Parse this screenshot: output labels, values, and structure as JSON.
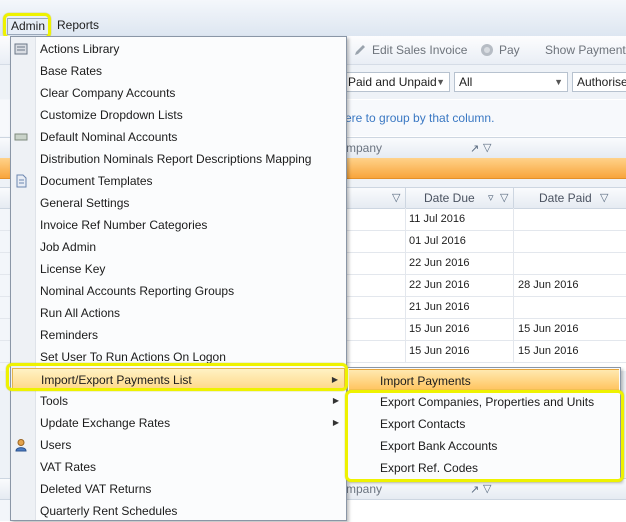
{
  "menubar": {
    "admin": "Admin",
    "reports": "Reports"
  },
  "toolbar": {
    "edit_sales_invoice": "Edit Sales Invoice",
    "pay": "Pay",
    "show_payment": "Show Payment"
  },
  "filters": {
    "status": "Paid and Unpaid",
    "scope": "All",
    "authorised": "Authorise"
  },
  "group_hint": "ere to group by that column.",
  "grid": {
    "group_column": "mpany",
    "columns": {
      "date_due": "Date Due",
      "date_paid": "Date Paid"
    },
    "rows": [
      {
        "date_due": "11 Jul 2016",
        "date_paid": ""
      },
      {
        "date_due": "01 Jul 2016",
        "date_paid": ""
      },
      {
        "date_due": "22 Jun 2016",
        "date_paid": ""
      },
      {
        "date_due": "22 Jun 2016",
        "date_paid": "28 Jun 2016"
      },
      {
        "date_due": "21 Jun 2016",
        "date_paid": ""
      },
      {
        "date_due": "15 Jun 2016",
        "date_paid": "15 Jun 2016"
      },
      {
        "date_due": "15 Jun 2016",
        "date_paid": "15 Jun 2016"
      }
    ],
    "lower_group_column": "mpany"
  },
  "admin_menu": {
    "items": [
      "Actions Library",
      "Base Rates",
      "Clear Company Accounts",
      "Customize Dropdown Lists",
      "Default Nominal Accounts",
      "Distribution Nominals Report Descriptions Mapping",
      "Document Templates",
      "General Settings",
      "Invoice Ref Number Categories",
      "Job Admin",
      "License Key",
      "Nominal Accounts Reporting Groups",
      "Run All Actions",
      "Reminders",
      "Set User To Run Actions On Logon",
      "Import/Export Payments List",
      "Tools",
      "Update Exchange Rates",
      "Users",
      "VAT Rates",
      "Deleted VAT Returns",
      "Quarterly Rent Schedules"
    ]
  },
  "submenu": {
    "items": [
      "Import Payments",
      "Export Companies, Properties and Units",
      "Export Contacts",
      "Export Bank Accounts",
      "Export  Ref. Codes"
    ]
  },
  "colors": {
    "highlight": "#eef200",
    "selected_row": "#f8a53c",
    "hint_text": "#3a78c3"
  }
}
